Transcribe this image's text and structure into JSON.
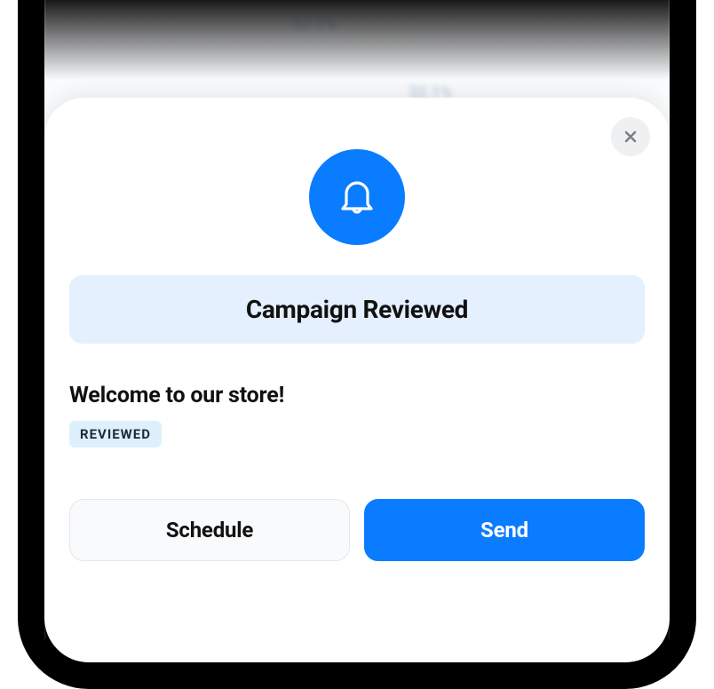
{
  "background": {
    "stat1": "57.1%",
    "stat2": "32.1%"
  },
  "modal": {
    "title": "Campaign Reviewed",
    "subtitle": "Welcome to our store!",
    "tag": "REVIEWED",
    "buttons": {
      "secondary": "Schedule",
      "primary": "Send"
    }
  }
}
